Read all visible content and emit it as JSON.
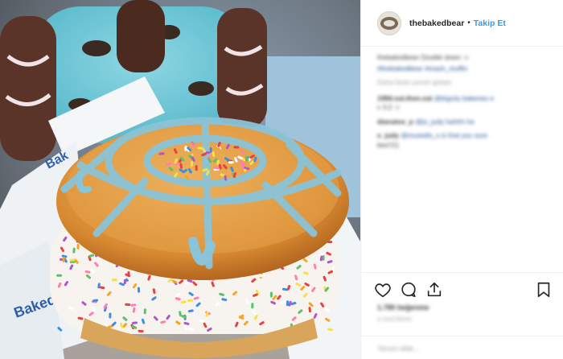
{
  "post": {
    "photo_alt": "",
    "sleeve_text": "Baked Bear",
    "username": "thebakedbear",
    "dot": "•",
    "follow_label": "Takip Et"
  },
  "comments": {
    "caption_line": "thebakedbear Double down ☺",
    "caption_links": "#thebakedbear #mash_muffin",
    "meta": "Daha fazla yorum göster",
    "items": [
      {
        "user": "1984.eat.then.eat",
        "text": "@bigcity bakeries e",
        "text2": "c 3.2 ☺"
      },
      {
        "user": "dianatoe_p",
        "text": "@jo_judy hahhh ha"
      },
      {
        "user": "e_judy",
        "text": "@mustafa_s is that you sure",
        "text2": "bes!!11"
      }
    ]
  },
  "stats": {
    "likes": "1.780 beğenme",
    "date": "4 HAZİRAN"
  },
  "add_comment": {
    "placeholder": "Yorum ekle..."
  },
  "icons": [
    "heart-icon",
    "comment-icon",
    "share-icon",
    "bookmark-icon"
  ]
}
